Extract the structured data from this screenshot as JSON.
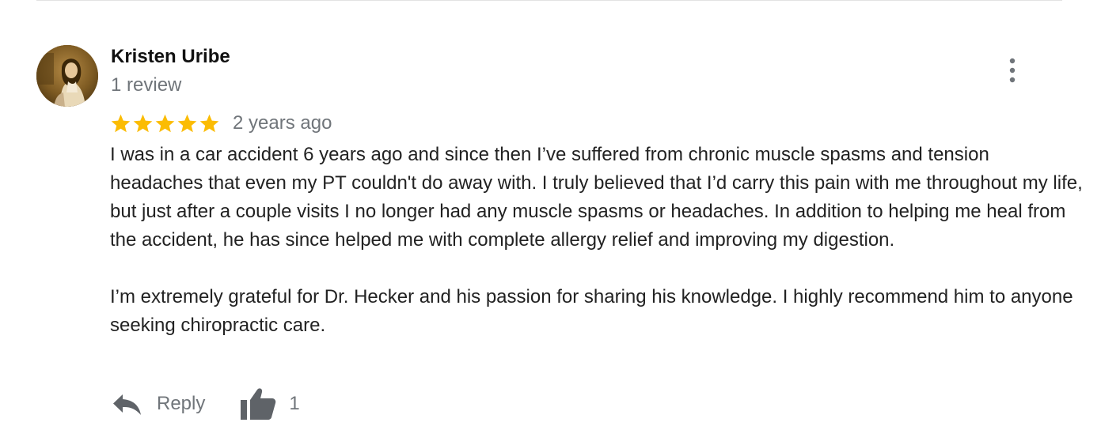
{
  "review": {
    "reviewer_name": "Kristen Uribe",
    "review_count": "1 review",
    "rating": 5,
    "rating_max": 5,
    "time_ago": "2 years ago",
    "paragraphs": [
      "I was in a car accident 6 years ago and since then I’ve suffered from chronic muscle spasms and tension headaches that even my PT couldn't do away with. I truly believed that I’d carry this pain with me throughout my life, but just after a couple visits I no longer had any muscle spasms or headaches. In addition to helping me heal from the accident, he has since helped me with complete allergy relief and improving my digestion.",
      "I’m extremely grateful for Dr. Hecker and his passion for sharing his knowledge. I highly recommend him to anyone seeking chiropractic care."
    ]
  },
  "actions": {
    "reply_label": "Reply",
    "like_count": "1"
  },
  "icons": {
    "avatar": "avatar-photo",
    "more": "more-vert-icon",
    "star": "star-icon",
    "reply": "reply-arrow-icon",
    "like": "thumbs-up-icon"
  },
  "colors": {
    "star": "#fbbc04",
    "secondary_text": "#70757a",
    "icon_gray": "#5f6368",
    "body_text": "#222222"
  }
}
